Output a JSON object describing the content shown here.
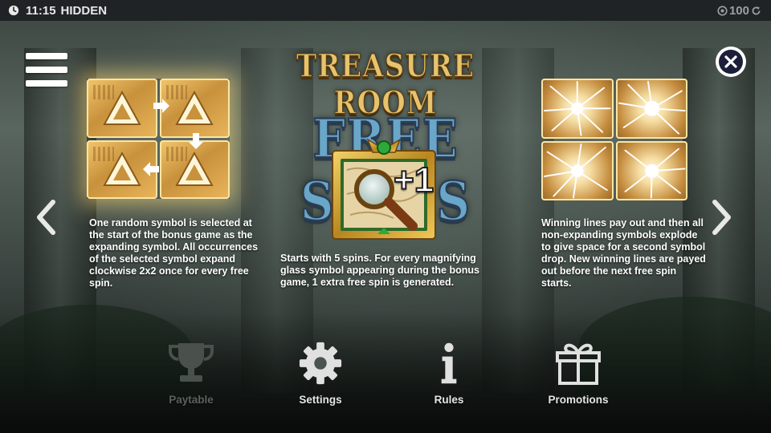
{
  "status_bar": {
    "time": "11:15",
    "player_name": "HIDDEN",
    "balance": "100",
    "clock_icon": "clock-icon",
    "credit_icon": "credit-icon",
    "refresh_icon": "refresh-icon"
  },
  "title": {
    "line1": "TREASURE ROOM",
    "line2": "FREE SPINS"
  },
  "panels": {
    "left": {
      "description": "One random symbol is selected at the start of the bonus game as the expanding symbol. All occurrences of the selected symbol expand clockwise 2x2 once for every free spin."
    },
    "center": {
      "badge": "+1",
      "description": "Starts with 5 spins. For every magnifying glass symbol appearing during the bonus game, 1 extra free spin is generated."
    },
    "right": {
      "description": "Winning lines pay out and then all non-expanding symbols explode to give space for a second symbol drop. New winning lines are payed out before the next free spin starts."
    }
  },
  "nav": {
    "paytable": {
      "label": "Paytable",
      "icon": "trophy-icon",
      "enabled": false
    },
    "settings": {
      "label": "Settings",
      "icon": "gear-icon",
      "enabled": true
    },
    "rules": {
      "label": "Rules",
      "icon": "info-icon",
      "enabled": true
    },
    "promotions": {
      "label": "Promotions",
      "icon": "gift-icon",
      "enabled": true
    }
  },
  "colors": {
    "status_bar_bg": "#1f2326",
    "title_gold": "#e6c36c",
    "title_blue": "#6aa6c8",
    "tile_gold": "#c8913c",
    "disabled_label": "#5c625e"
  }
}
